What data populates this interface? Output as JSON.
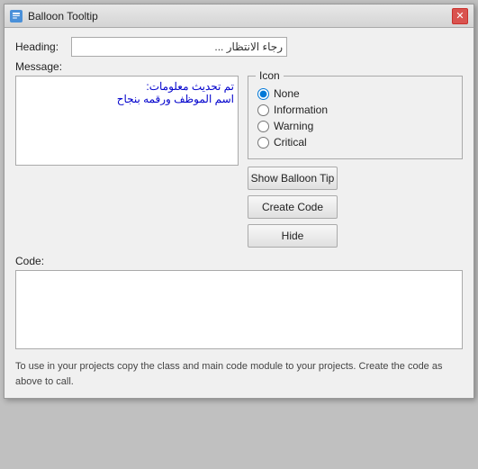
{
  "window": {
    "title": "Balloon Tooltip",
    "icon_label": "BT",
    "close_icon": "✕"
  },
  "form": {
    "heading_label": "Heading:",
    "heading_value": "رجاء الانتظار ...",
    "message_label": "Message:",
    "message_value": "تم تحديث معلومات:\nاسم الموظف ورقمه بنجاح"
  },
  "icon_group": {
    "legend": "Icon",
    "options": [
      {
        "id": "radio-none",
        "label": "None",
        "checked": true
      },
      {
        "id": "radio-information",
        "label": "Information",
        "checked": false
      },
      {
        "id": "radio-warning",
        "label": "Warning",
        "checked": false
      },
      {
        "id": "radio-critical",
        "label": "Critical",
        "checked": false
      }
    ]
  },
  "buttons": {
    "show_balloon_tip": "Show Balloon Tip",
    "create_code": "Create Code",
    "hide": "Hide"
  },
  "code_section": {
    "label": "Code:",
    "value": ""
  },
  "footer": {
    "text": "To use in your projects copy the class and main code module to your projects.  Create the code as above to call."
  }
}
